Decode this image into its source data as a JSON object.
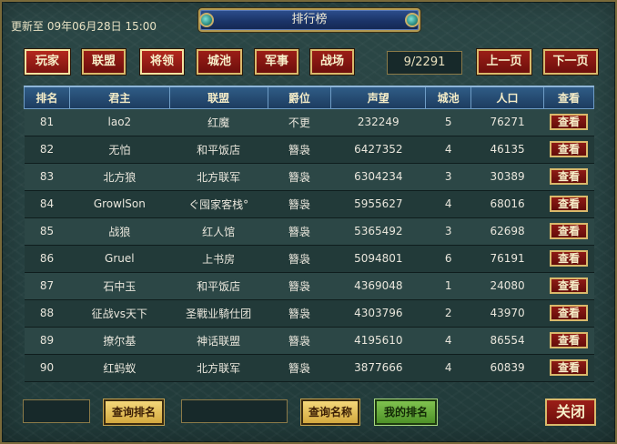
{
  "header": {
    "update_text": "更新至 09年06月28日 15:00",
    "title": "排行榜"
  },
  "tabs": [
    {
      "label": "玩家",
      "active": true
    },
    {
      "label": "联盟",
      "active": false
    },
    {
      "label": "将领",
      "active": true
    },
    {
      "label": "城池",
      "active": false
    },
    {
      "label": "军事",
      "active": false
    },
    {
      "label": "战场",
      "active": false
    }
  ],
  "pager": {
    "page_text": "9/2291",
    "prev_label": "上一页",
    "next_label": "下一页"
  },
  "table": {
    "headers": [
      "排名",
      "君主",
      "联盟",
      "爵位",
      "声望",
      "城池",
      "人口",
      "查看"
    ],
    "view_label": "查看",
    "rows": [
      {
        "rank": "81",
        "lord": "lao2",
        "alliance": "红魔",
        "title": "不更",
        "prestige": "232249",
        "cities": "5",
        "population": "76271"
      },
      {
        "rank": "82",
        "lord": "无怕",
        "alliance": "和平饭店",
        "title": "簪袅",
        "prestige": "6427352",
        "cities": "4",
        "population": "46135"
      },
      {
        "rank": "83",
        "lord": "北方狼",
        "alliance": "北方联军",
        "title": "簪袅",
        "prestige": "6304234",
        "cities": "3",
        "population": "30389"
      },
      {
        "rank": "84",
        "lord": "GrowlSon",
        "alliance": "ぐ囤家客栈°",
        "title": "簪袅",
        "prestige": "5955627",
        "cities": "4",
        "population": "68016"
      },
      {
        "rank": "85",
        "lord": "战狼",
        "alliance": "红人馆",
        "title": "簪袅",
        "prestige": "5365492",
        "cities": "3",
        "population": "62698"
      },
      {
        "rank": "86",
        "lord": "Gruel",
        "alliance": "上书房",
        "title": "簪袅",
        "prestige": "5094801",
        "cities": "6",
        "population": "76191"
      },
      {
        "rank": "87",
        "lord": "石中玉",
        "alliance": "和平饭店",
        "title": "簪袅",
        "prestige": "4369048",
        "cities": "1",
        "population": "24080"
      },
      {
        "rank": "88",
        "lord": "征战vs天下",
        "alliance": "圣戰业騎仕团",
        "title": "簪袅",
        "prestige": "4303796",
        "cities": "2",
        "population": "43970"
      },
      {
        "rank": "89",
        "lord": "撩尔基",
        "alliance": "神话联盟",
        "title": "簪袅",
        "prestige": "4195610",
        "cities": "4",
        "population": "86554"
      },
      {
        "rank": "90",
        "lord": "红蚂蚁",
        "alliance": "北方联军",
        "title": "簪袅",
        "prestige": "3877666",
        "cities": "4",
        "population": "60839"
      }
    ]
  },
  "footer": {
    "query_rank_label": "查询排名",
    "query_name_label": "查询名称",
    "my_rank_label": "我的排名",
    "close_label": "关闭",
    "rank_input_value": "",
    "name_input_value": ""
  },
  "colors": {
    "accent_red": "#8e1b15",
    "gold_border": "#d9b96b",
    "header_blue": "#2f5c86",
    "panel_teal": "#2b4746"
  }
}
